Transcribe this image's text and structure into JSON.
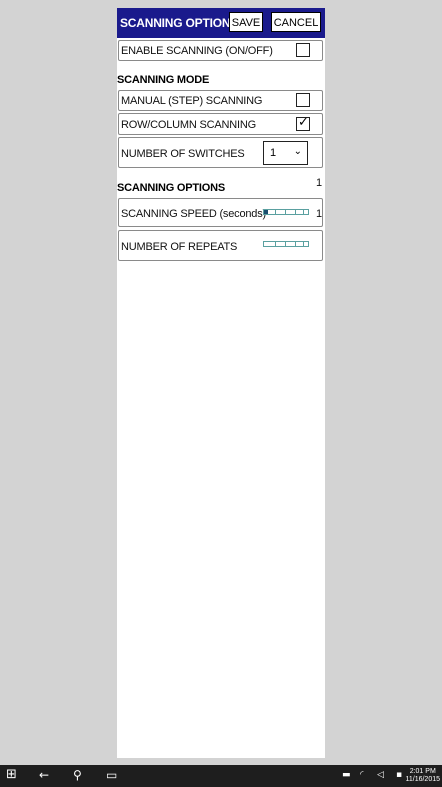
{
  "header": {
    "title": "SCANNING OPTIONS",
    "save_label": "SAVE",
    "cancel_label": "CANCEL",
    "bg_color": "#1a1a8c"
  },
  "enable": {
    "label": "ENABLE SCANNING (ON/OFF)",
    "checked": false
  },
  "mode": {
    "title": "SCANNING MODE",
    "manual_label": "MANUAL (STEP) SCANNING",
    "manual_checked": false,
    "rowcol_label": "ROW/COLUMN SCANNING",
    "rowcol_checked": true,
    "check_mark": "✓",
    "switches_label": "NUMBER OF SWITCHES",
    "switches_value": "1",
    "chevron": "⌄"
  },
  "options": {
    "title": "SCANNING OPTIONS",
    "top_value": "1",
    "speed_label": "SCANNING SPEED (seconds)",
    "speed_value": "1",
    "speed_fraction": 0.1,
    "repeats_label": "NUMBER OF REPEATS",
    "repeats_fraction": 0
  },
  "taskbar": {
    "start_icon": "⊞",
    "back_icon": "←",
    "search_icon": "⚲",
    "taskview_icon": "▭",
    "time": "2:01 PM",
    "date": "11/16/2015"
  }
}
